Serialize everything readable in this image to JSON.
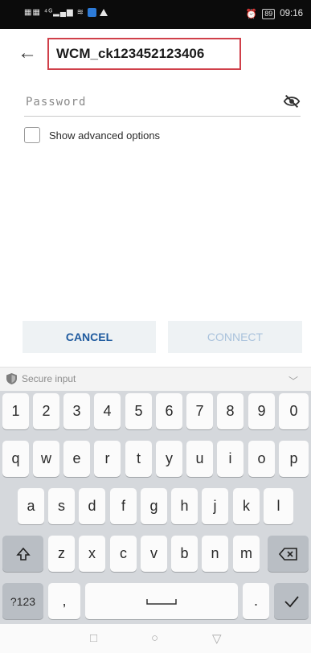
{
  "status_bar": {
    "time": "09:16",
    "battery": "89"
  },
  "header": {
    "title": "WCM_ck123452123406"
  },
  "password": {
    "placeholder": "Password"
  },
  "advanced": {
    "label": "Show advanced options"
  },
  "buttons": {
    "cancel": "CANCEL",
    "connect": "CONNECT"
  },
  "keyboard": {
    "secure_label": "Secure input",
    "row_numbers": [
      "1",
      "2",
      "3",
      "4",
      "5",
      "6",
      "7",
      "8",
      "9",
      "0"
    ],
    "row_q": [
      "q",
      "w",
      "e",
      "r",
      "t",
      "y",
      "u",
      "i",
      "o",
      "p"
    ],
    "row_a": [
      "a",
      "s",
      "d",
      "f",
      "g",
      "h",
      "j",
      "k",
      "l"
    ],
    "row_z": [
      "z",
      "x",
      "c",
      "v",
      "b",
      "n",
      "m"
    ],
    "sym_label": "?123",
    "comma": ",",
    "period": "."
  },
  "colors": {
    "accent": "#1e5a9e",
    "highlight_border": "#d0404a",
    "keyboard_bg": "#d5d8dc"
  }
}
